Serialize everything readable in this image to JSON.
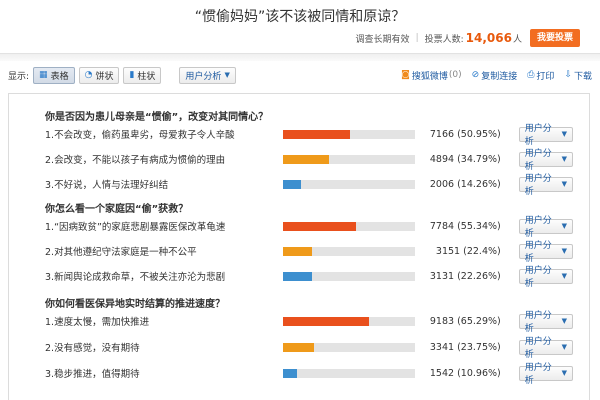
{
  "title": "“惯偷妈妈”该不该被同情和原谅？",
  "meta": {
    "validity": "调查长期有效",
    "voters_label": "投票人数:",
    "voters_count": "14,066",
    "voters_unit": "人",
    "vote_button": "我要投票"
  },
  "toolbar": {
    "display_label": "显示:",
    "views": [
      {
        "label": "表格",
        "icon": "table-icon",
        "active": true
      },
      {
        "label": "饼状",
        "icon": "pie-icon",
        "active": false
      },
      {
        "label": "柱状",
        "icon": "bar-chart-icon",
        "active": false
      }
    ],
    "user_analysis": "用户分析",
    "weibo_label": "搜狐微博",
    "weibo_count": "(0)",
    "copy_link": "复制连接",
    "print": "打印",
    "download": "下载"
  },
  "row_button": "用户分析",
  "questions": [
    {
      "title": "你是否因为患儿母亲是“惯偷”，改变对其同情心？",
      "options": [
        {
          "text": "1.不会改变，偷药虽卑劣，母爱救子令人辛酸",
          "votes": "7166",
          "percent_label": "(50.95%)",
          "percent": 50.95,
          "color": "#e9501d"
        },
        {
          "text": "2.会改变，不能以孩子有病成为惯偷的理由",
          "votes": "4894",
          "percent_label": "(34.79%)",
          "percent": 34.79,
          "color": "#ef9a1a"
        },
        {
          "text": "3.不好说，人情与法理好纠结",
          "votes": "2006",
          "percent_label": "(14.26%)",
          "percent": 14.26,
          "color": "#3d8fcf"
        }
      ]
    },
    {
      "title": "你怎么看一个家庭因“偷”获救？",
      "options": [
        {
          "text": "1.“因病致贫”的家庭悲剧暴露医保改革龟速",
          "votes": "7784",
          "percent_label": "(55.34%)",
          "percent": 55.34,
          "color": "#e9501d"
        },
        {
          "text": "2.对其他遵纪守法家庭是一种不公平",
          "votes": "3151",
          "percent_label": "(22.4%)",
          "percent": 22.4,
          "color": "#ef9a1a"
        },
        {
          "text": "3.新闻舆论成救命草，不被关注亦沦为悲剧",
          "votes": "3131",
          "percent_label": "(22.26%)",
          "percent": 22.26,
          "color": "#3d8fcf"
        }
      ]
    },
    {
      "title": "你如何看医保异地实时结算的推进速度？",
      "options": [
        {
          "text": "1.速度太慢，需加快推进",
          "votes": "9183",
          "percent_label": "(65.29%)",
          "percent": 65.29,
          "color": "#e9501d"
        },
        {
          "text": "2.没有感觉，没有期待",
          "votes": "3341",
          "percent_label": "(23.75%)",
          "percent": 23.75,
          "color": "#ef9a1a"
        },
        {
          "text": "3.稳步推进，值得期待",
          "votes": "1542",
          "percent_label": "(10.96%)",
          "percent": 10.96,
          "color": "#3d8fcf"
        }
      ]
    }
  ]
}
